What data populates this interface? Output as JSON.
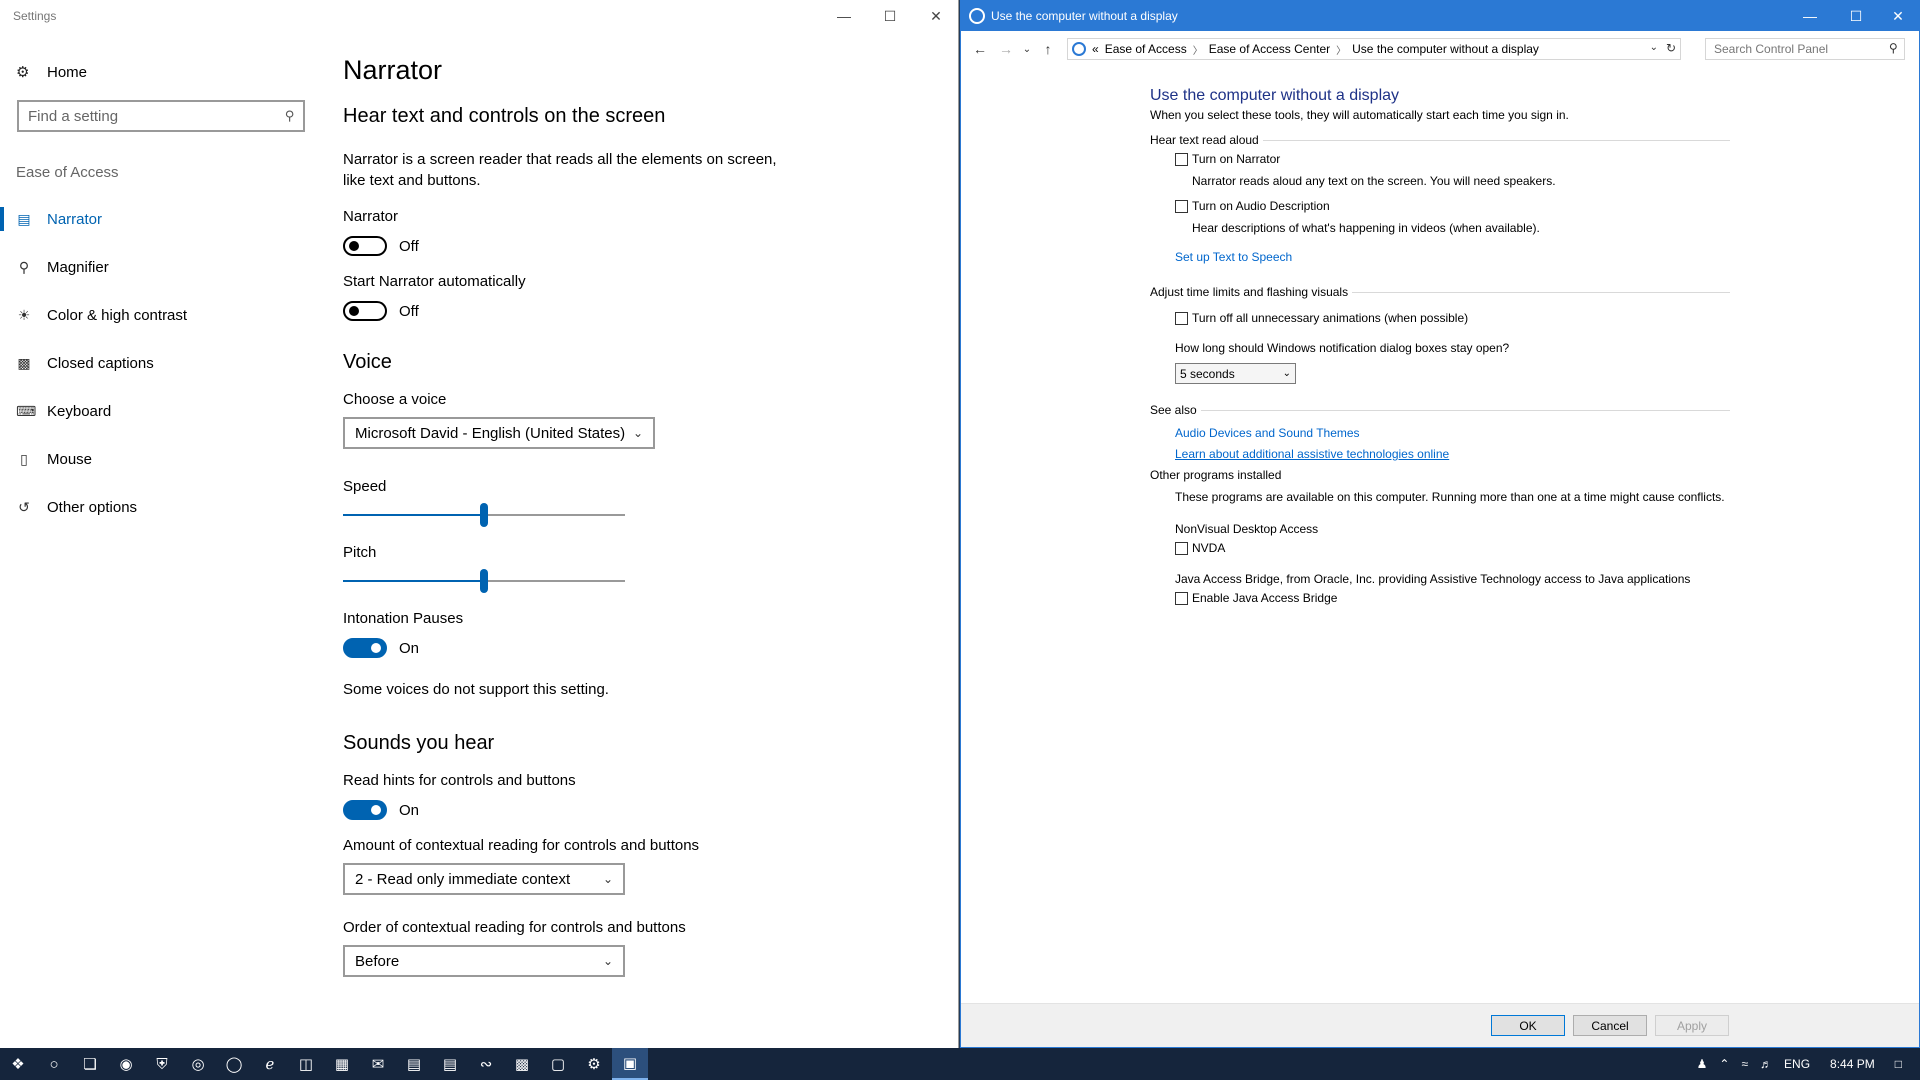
{
  "settings": {
    "window_title": "Settings",
    "nav": {
      "home": "Home",
      "search_placeholder": "Find a setting",
      "section": "Ease of Access",
      "items": [
        {
          "label": "Narrator",
          "icon": "narrator-icon"
        },
        {
          "label": "Magnifier",
          "icon": "magnifier-icon"
        },
        {
          "label": "Color & high contrast",
          "icon": "brightness-icon"
        },
        {
          "label": "Closed captions",
          "icon": "captions-icon"
        },
        {
          "label": "Keyboard",
          "icon": "keyboard-icon"
        },
        {
          "label": "Mouse",
          "icon": "mouse-icon"
        },
        {
          "label": "Other options",
          "icon": "other-options-icon"
        }
      ]
    },
    "main": {
      "title": "Narrator",
      "subtitle": "Hear text and controls on the screen",
      "description": "Narrator is a screen reader that reads all the elements on screen, like text and buttons.",
      "narrator_label": "Narrator",
      "narrator_state": "Off",
      "autostart_label": "Start Narrator automatically",
      "autostart_state": "Off",
      "voice_heading": "Voice",
      "choose_voice_label": "Choose a voice",
      "voice_value": "Microsoft David - English (United States)",
      "speed_label": "Speed",
      "speed_value": 0.5,
      "pitch_label": "Pitch",
      "pitch_value": 0.5,
      "intonation_label": "Intonation Pauses",
      "intonation_state": "On",
      "voices_note": "Some voices do not support this setting.",
      "sounds_heading": "Sounds you hear",
      "read_hints_label": "Read hints for controls and buttons",
      "read_hints_state": "On",
      "context_amount_label": "Amount of contextual reading for controls and buttons",
      "context_amount_value": "2 - Read only immediate context",
      "context_order_label": "Order of contextual reading for controls and buttons",
      "context_order_value": "Before"
    }
  },
  "control_panel": {
    "window_title": "Use the computer without a display",
    "breadcrumb": [
      "Ease of Access",
      "Ease of Access Center",
      "Use the computer without a display"
    ],
    "breadcrumb_prefix": "«",
    "search_placeholder": "Search Control Panel",
    "heading": "Use the computer without a display",
    "subheading": "When you select these tools, they will automatically start each time you sign in.",
    "group1_title": "Hear text read aloud",
    "narrator_checkbox": "Turn on Narrator",
    "narrator_desc": "Narrator reads aloud any text on the screen. You will need speakers.",
    "audio_desc_checkbox": "Turn on Audio Description",
    "audio_desc_desc": "Hear descriptions of what's happening in videos (when available).",
    "tts_link": "Set up Text to Speech",
    "group2_title": "Adjust time limits and flashing visuals",
    "animations_checkbox": "Turn off all unnecessary animations (when possible)",
    "notification_question": "How long should Windows notification dialog boxes stay open?",
    "notification_value": "5 seconds",
    "see_also_title": "See also",
    "see_also_link1": "Audio Devices and Sound Themes",
    "see_also_link2": "Learn about additional assistive technologies online",
    "other_programs_title": "Other programs installed",
    "other_programs_desc": "These programs are available on this computer. Running more than one at a time might cause conflicts.",
    "nvda_group": "NonVisual Desktop Access",
    "nvda_checkbox": "NVDA",
    "java_group": "Java Access Bridge, from Oracle, Inc. providing Assistive Technology access to Java applications",
    "java_checkbox": "Enable Java Access Bridge",
    "ok": "OK",
    "cancel": "Cancel",
    "apply": "Apply"
  },
  "taskbar": {
    "language": "ENG",
    "time": "8:44 PM"
  },
  "colors": {
    "accent": "#0063b1",
    "cp_title": "#2b79d4",
    "taskbar": "#15253c"
  }
}
